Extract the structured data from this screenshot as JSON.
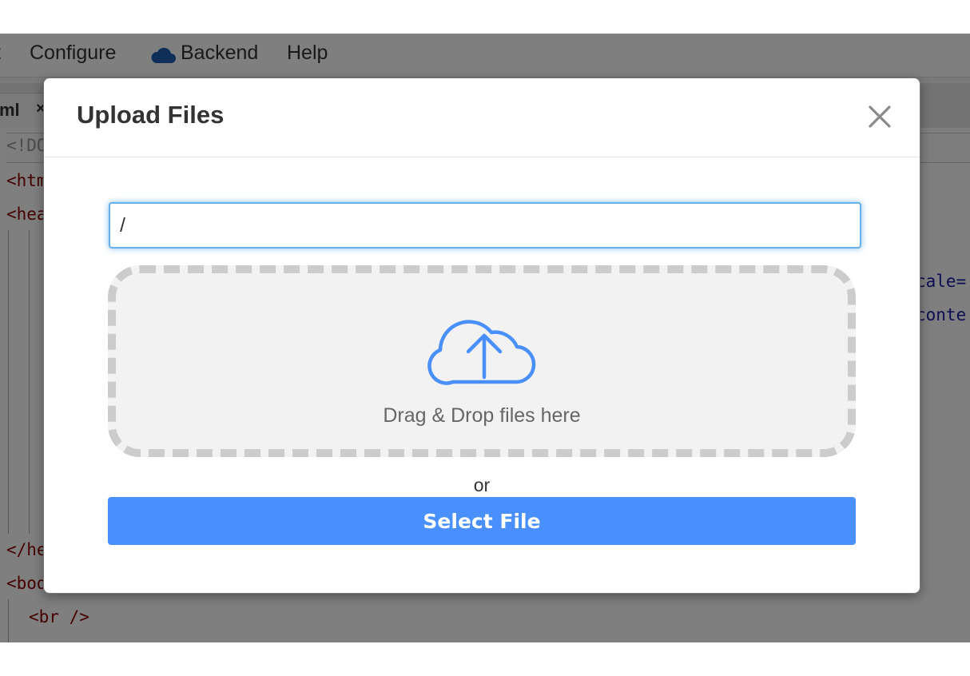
{
  "menubar": {
    "items": [
      {
        "label": "t"
      },
      {
        "label": "Configure"
      },
      {
        "label": "Backend",
        "icon": "cloud-icon"
      },
      {
        "label": "Help"
      }
    ]
  },
  "tabbar": {
    "tab": {
      "label": "ml",
      "close": "×"
    }
  },
  "editor": {
    "lines": [
      {
        "text": "<!DO"
      },
      {
        "text": "<htm"
      },
      {
        "text": "<hea"
      },
      {
        "text": "</he"
      },
      {
        "text": "<bod"
      },
      {
        "text": "<br />"
      }
    ],
    "right_fragments": [
      {
        "text": "cale="
      },
      {
        "text": "conte"
      }
    ]
  },
  "modal": {
    "title": "Upload Files",
    "close_icon": "close-icon",
    "path_input": {
      "value": "/"
    },
    "dropzone": {
      "icon": "cloud-upload-icon",
      "label": "Drag & Drop files here"
    },
    "or_label": "or",
    "select_button": "Select File"
  },
  "colors": {
    "accent": "#4a90fc",
    "icon_blue": "#4a90fc",
    "overlay": "rgba(0,0,0,0.5)"
  }
}
